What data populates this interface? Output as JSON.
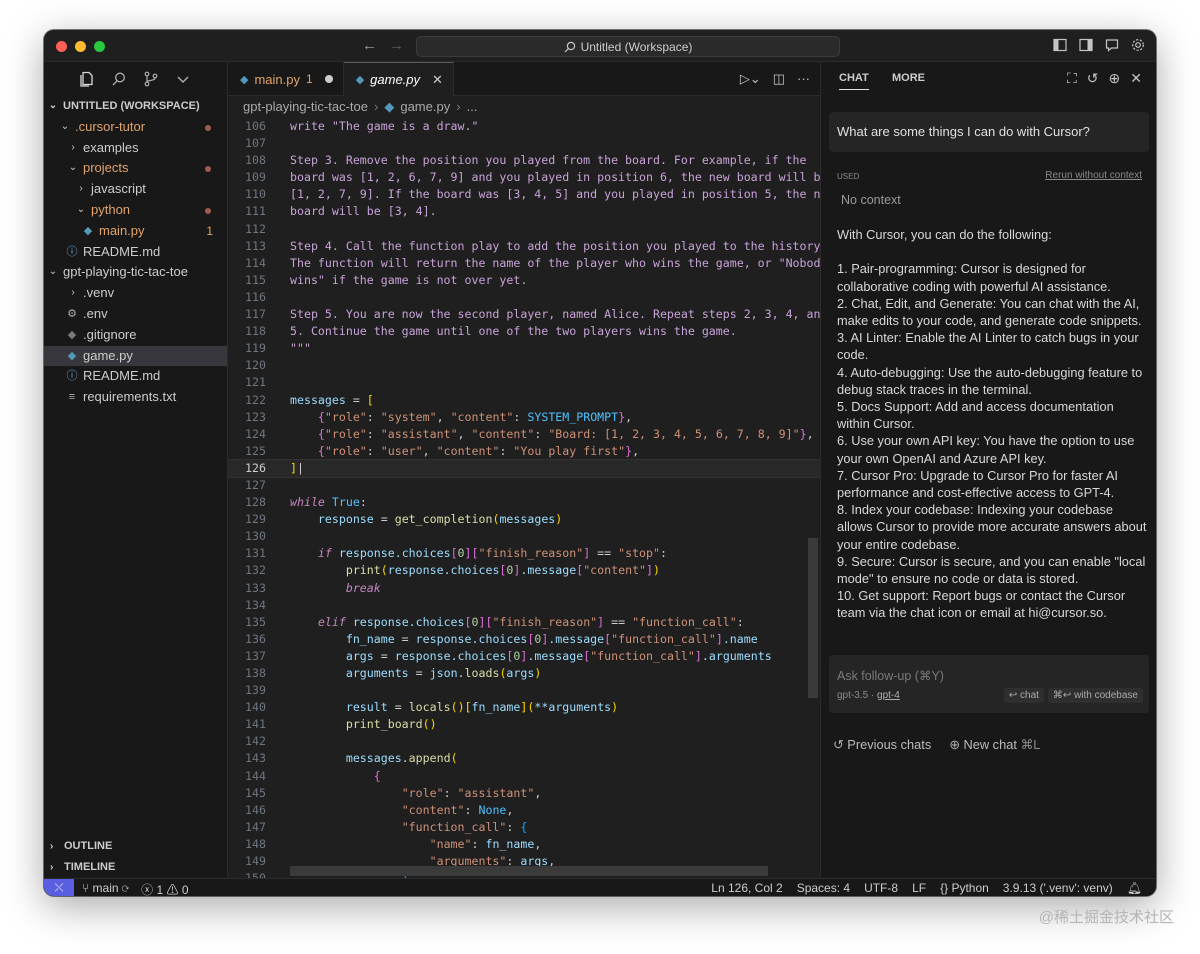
{
  "window": {
    "search_title": "Untitled (Workspace)",
    "nav_back": "←",
    "nav_forward": "→"
  },
  "sidebar": {
    "workspace_header": "UNTITLED (WORKSPACE)",
    "items": [
      {
        "label": ".cursor-tutor",
        "indent": 0,
        "chev": "⌄",
        "mod": true,
        "dot": true
      },
      {
        "label": "examples",
        "indent": 1,
        "chev": "›"
      },
      {
        "label": "projects",
        "indent": 1,
        "chev": "⌄",
        "mod": true,
        "dot": true
      },
      {
        "label": "javascript",
        "indent": 2,
        "chev": "›"
      },
      {
        "label": "python",
        "indent": 2,
        "chev": "⌄",
        "mod": true,
        "dot": true
      },
      {
        "label": "main.py",
        "indent": 3,
        "icon": "python",
        "mod": true,
        "count": "1"
      },
      {
        "label": "README.md",
        "indent": 1,
        "icon": "info"
      },
      {
        "label": "gpt-playing-tic-tac-toe",
        "indent": 0,
        "chev": "⌄"
      },
      {
        "label": ".venv",
        "indent": 1,
        "chev": "›"
      },
      {
        "label": ".env",
        "indent": 1,
        "icon": "gear"
      },
      {
        "label": ".gitignore",
        "indent": 1,
        "icon": "git"
      },
      {
        "label": "game.py",
        "indent": 1,
        "icon": "python",
        "selected": true
      },
      {
        "label": "README.md",
        "indent": 1,
        "icon": "info"
      },
      {
        "label": "requirements.txt",
        "indent": 1,
        "icon": "lines"
      }
    ],
    "outline": "OUTLINE",
    "timeline": "TIMELINE"
  },
  "editor": {
    "tabs": [
      {
        "label": "main.py",
        "badge": "1"
      },
      {
        "label": "game.py"
      }
    ],
    "breadcrumb": [
      "gpt-playing-tic-tac-toe",
      "game.py",
      "..."
    ],
    "current_line": 126
  },
  "chat": {
    "tabs": [
      "CHAT",
      "MORE"
    ],
    "question": "What are some things I can do with Cursor?",
    "used_label": "USED",
    "rerun_label": "Rerun without context",
    "no_context": "No context",
    "answer": [
      "With Cursor, you can do the following:",
      "",
      "1. Pair-programming: Cursor is designed for collaborative coding with powerful AI assistance.",
      "2. Chat, Edit, and Generate: You can chat with the AI, make edits to your code, and generate code snippets.",
      "3. AI Linter: Enable the AI Linter to catch bugs in your code.",
      "4. Auto-debugging: Use the auto-debugging feature to debug stack traces in the terminal.",
      "5. Docs Support: Add and access documentation within Cursor.",
      "6. Use your own API key: You have the option to use your own OpenAI and Azure API key.",
      "7. Cursor Pro: Upgrade to Cursor Pro for faster AI performance and cost-effective access to GPT-4.",
      "8. Index your codebase: Indexing your codebase allows Cursor to provide more accurate answers about your entire codebase.",
      "9. Secure: Cursor is secure, and you can enable \"local mode\" to ensure no code or data is stored.",
      "10. Get support: Report bugs or contact the Cursor team via the chat icon or email at hi@cursor.so."
    ],
    "followup_placeholder": "Ask follow-up (⌘Y)",
    "model_a": "gpt-3.5",
    "model_sep": " · ",
    "model_b": "gpt-4",
    "chat_btn": "↩ chat",
    "codebase_btn": "⌘↩ with codebase",
    "previous_chats": "Previous chats",
    "new_chat": "New chat",
    "new_chat_kbd": "⌘L"
  },
  "statusbar": {
    "branch": "main",
    "errors": "1",
    "warnings": "0",
    "position": "Ln 126, Col 2",
    "spaces": "Spaces: 4",
    "encoding": "UTF-8",
    "eol": "LF",
    "language": "Python",
    "interpreter": "3.9.13 ('.venv': venv)"
  },
  "watermark": "@稀土掘金技术社区"
}
